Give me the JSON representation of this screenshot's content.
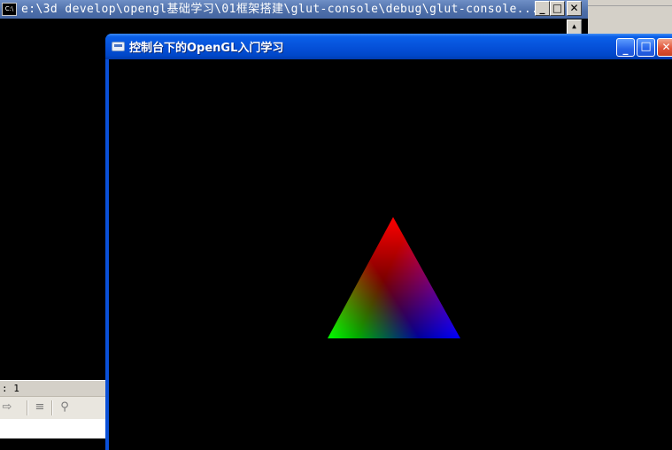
{
  "console_window": {
    "title": "e:\\3d develop\\opengl基础学习\\01框架搭建\\glut-console\\debug\\glut-console...",
    "icon_label": "C:\\",
    "buttons": {
      "minimize": "_",
      "maximize": "□",
      "close": "✕"
    }
  },
  "ide": {
    "status_text": ": 1",
    "toolbar_icons": [
      "forward-icon",
      "clear-icon",
      "find-icon"
    ]
  },
  "glut_window": {
    "title": "控制台下的OpenGL入门学习",
    "buttons": {
      "minimize": "_",
      "maximize": "□",
      "close": "✕"
    },
    "triangle": {
      "vertex_colors": {
        "top": "#ff0000",
        "bottom_left": "#00ff00",
        "bottom_right": "#0000ff"
      }
    }
  },
  "colors": {
    "xp_titlebar": "#0550d8",
    "classic_titlebar": "#4d6ea8",
    "client_background": "#000000"
  }
}
